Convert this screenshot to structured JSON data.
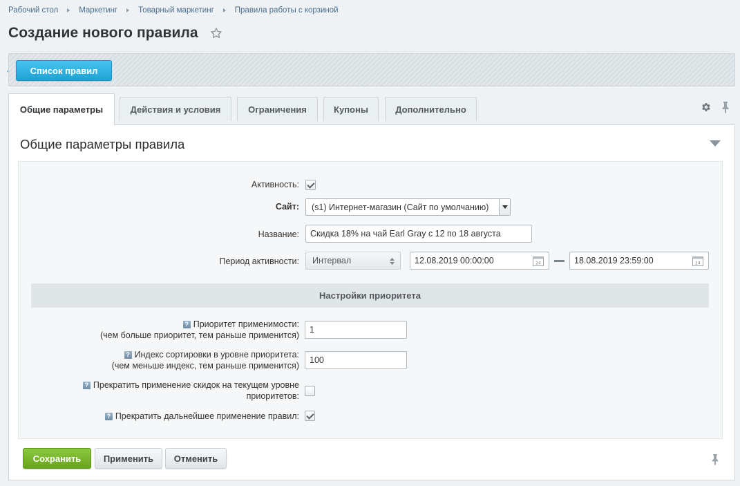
{
  "breadcrumb": [
    "Рабочий стол",
    "Маркетинг",
    "Товарный маркетинг",
    "Правила работы с корзиной"
  ],
  "page": {
    "title": "Создание нового правила"
  },
  "toolbar": {
    "list_button": "Список правил"
  },
  "tabs": [
    {
      "label": "Общие параметры",
      "active": true
    },
    {
      "label": "Действия и условия"
    },
    {
      "label": "Ограничения"
    },
    {
      "label": "Купоны"
    },
    {
      "label": "Дополнительно"
    }
  ],
  "section": {
    "title": "Общие параметры правила",
    "priority_header": "Настройки приоритета"
  },
  "form": {
    "active_label": "Активность:",
    "active_checked": true,
    "site_label": "Сайт:",
    "site_value": "(s1) Интернет-магазин (Сайт по умолчанию)",
    "name_label": "Название:",
    "name_value": "Скидка 18% на чай Earl Gray с 12 по 18 августа",
    "period_label": "Период активности:",
    "period_type": "Интервал",
    "period_from": "12.08.2019 00:00:00",
    "period_to": "18.08.2019 23:59:00",
    "priority_label_1": "Приоритет применимости:",
    "priority_label_2": "(чем больше приоритет, тем раньше применится)",
    "priority_value": "1",
    "sort_label_1": "Индекс сортировки в уровне приоритета:",
    "sort_label_2": "(чем меньше индекс, тем раньше применится)",
    "sort_value": "100",
    "stop_level_label_1": "Прекратить применение скидок на текущем уровне",
    "stop_level_label_2": "приоритетов:",
    "stop_level_checked": false,
    "stop_further_label": "Прекратить дальнейшее применение правил:",
    "stop_further_checked": true,
    "help_glyph": "?"
  },
  "buttons": {
    "save": "Сохранить",
    "apply": "Применить",
    "cancel": "Отменить"
  },
  "colors": {
    "accent_blue": "#1fa2d6",
    "save_green": "#6aa51e",
    "link": "#4a6d8f"
  }
}
